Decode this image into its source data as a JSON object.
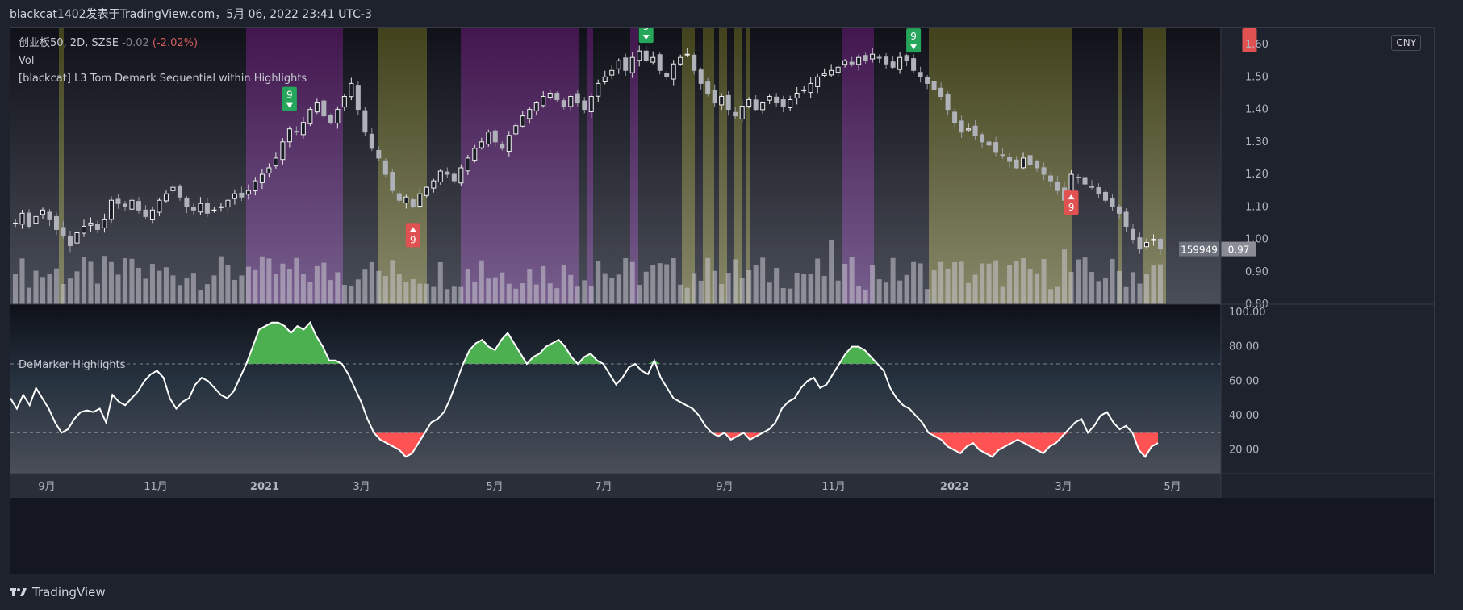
{
  "header": {
    "title": "blackcat1402发表于TradingView.com，5月 06, 2022 23:41 UTC-3"
  },
  "legend": {
    "symbol": "创业板50, 2D, SZSE",
    "change": "-0.02",
    "change_pct": "(-2.02%)",
    "volume_label": "Vol",
    "indicator_label": "[blackcat] L3 Tom Demark Sequential within Highlights"
  },
  "currency_badge": "CNY",
  "last_volume_tag": "159949",
  "last_price_tag": "0.97",
  "lower_pane_title": "DeMarker Highlights",
  "footer": {
    "brand": "TradingView"
  },
  "colors": {
    "bullish_fill": "#4caf50",
    "bearish_fill": "#ff5252",
    "demarker_line": "#ffffff",
    "purple_highlight": "#7b1fa2",
    "olive_highlight": "#a0a040",
    "buy_signal": "#26a65b",
    "sell_signal": "#e05252"
  },
  "chart_data": [
    {
      "type": "candlestick",
      "title": "创业板50, 2D, SZSE",
      "x_ticks": [
        "9月",
        "11月",
        "2021",
        "3月",
        "5月",
        "7月",
        "9月",
        "11月",
        "2022",
        "3月",
        "5月"
      ],
      "x_tick_positions": [
        0.03,
        0.12,
        0.21,
        0.29,
        0.4,
        0.49,
        0.59,
        0.68,
        0.78,
        0.87,
        0.96
      ],
      "ylim": [
        0.8,
        1.65
      ],
      "y_ticks": [
        "1.60",
        "1.50",
        "1.40",
        "1.30",
        "1.20",
        "1.10",
        "1.00",
        "0.90",
        "0.80"
      ],
      "y_tick_values": [
        1.6,
        1.5,
        1.4,
        1.3,
        1.2,
        1.1,
        1.0,
        0.9,
        0.8
      ],
      "close": [
        1.05,
        1.08,
        1.04,
        1.07,
        1.09,
        1.06,
        1.03,
        1.01,
        0.98,
        1.02,
        1.04,
        1.05,
        1.03,
        1.06,
        1.12,
        1.11,
        1.1,
        1.12,
        1.09,
        1.07,
        1.09,
        1.12,
        1.14,
        1.16,
        1.13,
        1.1,
        1.09,
        1.11,
        1.08,
        1.09,
        1.1,
        1.12,
        1.14,
        1.13,
        1.15,
        1.18,
        1.2,
        1.22,
        1.25,
        1.3,
        1.34,
        1.33,
        1.36,
        1.4,
        1.42,
        1.38,
        1.36,
        1.4,
        1.44,
        1.48,
        1.4,
        1.33,
        1.28,
        1.25,
        1.2,
        1.15,
        1.12,
        1.13,
        1.1,
        1.14,
        1.16,
        1.18,
        1.21,
        1.2,
        1.18,
        1.22,
        1.25,
        1.28,
        1.3,
        1.33,
        1.3,
        1.28,
        1.32,
        1.35,
        1.38,
        1.4,
        1.42,
        1.44,
        1.45,
        1.43,
        1.41,
        1.44,
        1.42,
        1.4,
        1.44,
        1.48,
        1.5,
        1.52,
        1.55,
        1.52,
        1.56,
        1.58,
        1.55,
        1.56,
        1.52,
        1.5,
        1.54,
        1.56,
        1.57,
        1.52,
        1.48,
        1.45,
        1.42,
        1.44,
        1.4,
        1.38,
        1.41,
        1.43,
        1.4,
        1.42,
        1.44,
        1.42,
        1.41,
        1.43,
        1.45,
        1.46,
        1.48,
        1.5,
        1.51,
        1.52,
        1.53,
        1.55,
        1.54,
        1.56,
        1.55,
        1.57,
        1.56,
        1.54,
        1.53,
        1.56,
        1.55,
        1.52,
        1.5,
        1.48,
        1.46,
        1.44,
        1.4,
        1.36,
        1.33,
        1.34,
        1.32,
        1.3,
        1.29,
        1.27,
        1.26,
        1.24,
        1.22,
        1.25,
        1.23,
        1.22,
        1.2,
        1.18,
        1.15,
        1.12,
        1.2,
        1.19,
        1.17,
        1.16,
        1.14,
        1.12,
        1.1,
        1.08,
        1.04,
        1.0,
        0.97,
        0.99,
        1.0,
        0.97
      ],
      "volume": [
        159949
      ],
      "bull_signal_labels": [
        "9",
        "9",
        "9"
      ],
      "bear_signal_labels": [
        "9",
        "9",
        "9"
      ],
      "last_price": 0.97,
      "last_volume": 159949
    },
    {
      "type": "line",
      "title": "DeMarker Highlights",
      "ylim": [
        0,
        100
      ],
      "y_ticks": [
        "100.00",
        "80.00",
        "60.00",
        "40.00",
        "20.00"
      ],
      "y_tick_values": [
        100,
        80,
        60,
        40,
        20
      ],
      "overbought": 70,
      "oversold": 30,
      "values": [
        50,
        44,
        52,
        46,
        56,
        50,
        44,
        36,
        30,
        32,
        38,
        42,
        43,
        42,
        44,
        36,
        52,
        48,
        46,
        50,
        54,
        60,
        64,
        66,
        62,
        50,
        44,
        48,
        50,
        58,
        62,
        60,
        56,
        52,
        50,
        54,
        62,
        70,
        80,
        90,
        92,
        94,
        94,
        92,
        88,
        92,
        90,
        94,
        86,
        80,
        72,
        72,
        70,
        64,
        56,
        48,
        38,
        30,
        26,
        24,
        22,
        20,
        16,
        18,
        24,
        30,
        36,
        38,
        42,
        50,
        60,
        70,
        78,
        82,
        84,
        80,
        78,
        84,
        88,
        82,
        76,
        70,
        74,
        76,
        80,
        82,
        84,
        80,
        74,
        70,
        74,
        76,
        72,
        70,
        64,
        58,
        62,
        68,
        70,
        66,
        64,
        72,
        62,
        56,
        50,
        48,
        46,
        44,
        40,
        34,
        30,
        28,
        30,
        26,
        28,
        30,
        26,
        28,
        30,
        32,
        36,
        44,
        48,
        50,
        56,
        60,
        62,
        56,
        58,
        64,
        70,
        76,
        80,
        80,
        78,
        74,
        70,
        66,
        56,
        50,
        46,
        44,
        40,
        36,
        30,
        28,
        26,
        22,
        20,
        18,
        22,
        24,
        20,
        18,
        16,
        20,
        22,
        24,
        26,
        24,
        22,
        20,
        18,
        22,
        24,
        28,
        32,
        36,
        38,
        30,
        34,
        40,
        42,
        36,
        32,
        34,
        30,
        20,
        16,
        22,
        24
      ],
      "fill_above_70": "#4caf50",
      "fill_below_30": "#ff5252"
    }
  ]
}
